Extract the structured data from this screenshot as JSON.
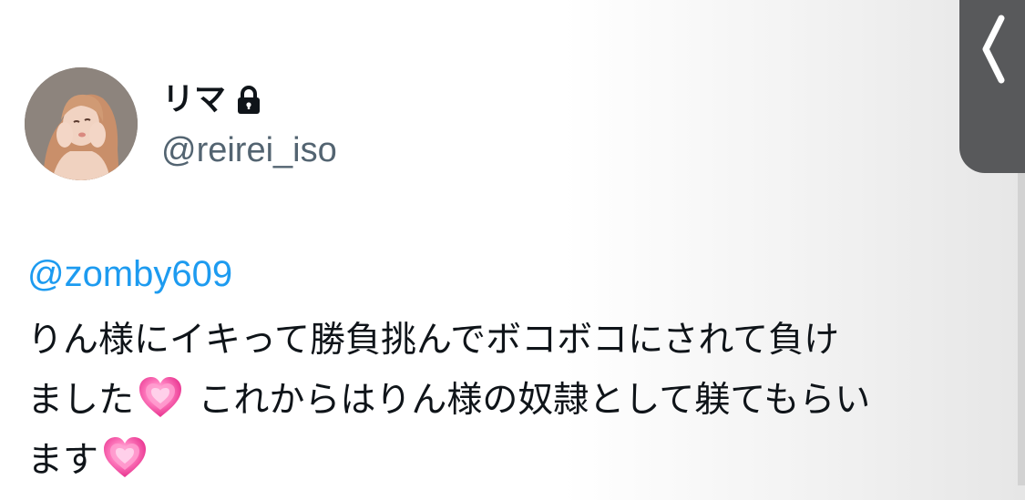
{
  "author": {
    "display_name": "リマ",
    "handle": "@reirei_iso",
    "protected": true,
    "avatar": "profile-photo"
  },
  "tweet": {
    "reply_mention": "@zomby609",
    "lines": [
      "りん様にイキって勝負挑んでボコボコにされて負け",
      [
        "ました",
        " これからはりん様の奴隷として躾てもらい"
      ],
      [
        "ます"
      ]
    ]
  },
  "side_panel": {
    "icon": "chevron-left-icon"
  },
  "colors": {
    "mention": "#1d9bf0",
    "handle": "#536471",
    "text": "#0f1419",
    "heart": "#ff4fa8",
    "side_tab": "#58595b"
  }
}
